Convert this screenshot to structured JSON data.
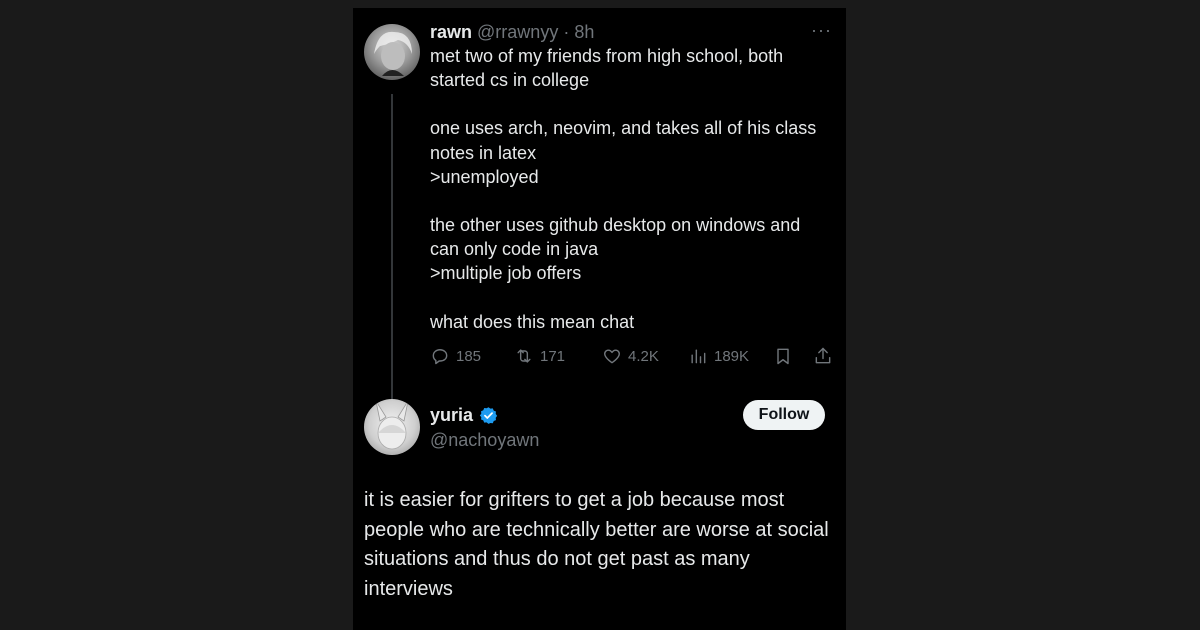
{
  "tweet1": {
    "name": "rawn",
    "handle": "@rrawnyy",
    "time_sep": "·",
    "time": "8h",
    "more_label": "···",
    "avatar_icon": "anime-avatar-icon",
    "body": [
      "met two of my friends from high school, both",
      "started cs in college",
      "",
      "one uses arch, neovim, and takes all of his class",
      "notes in latex",
      ">unemployed",
      "",
      "the other uses github desktop on windows and",
      "can only code in java",
      ">multiple job offers",
      "",
      "what does this mean chat"
    ],
    "actions": {
      "replies": "185",
      "reposts": "171",
      "likes": "4.2K",
      "views": "189K"
    }
  },
  "tweet2": {
    "name": "yuria",
    "handle": "@nachoyawn",
    "verified_icon": "verified-badge-icon",
    "follow_label": "Follow",
    "body": "it is easier for grifters to get a job because most people who are technically better are worse at social situations and thus do not get past as many interviews"
  },
  "colors": {
    "background": "#000000",
    "text": "#e7e9ea",
    "muted": "#71767b",
    "verified": "#1d9bf0",
    "follow_bg": "#eff3f4"
  }
}
